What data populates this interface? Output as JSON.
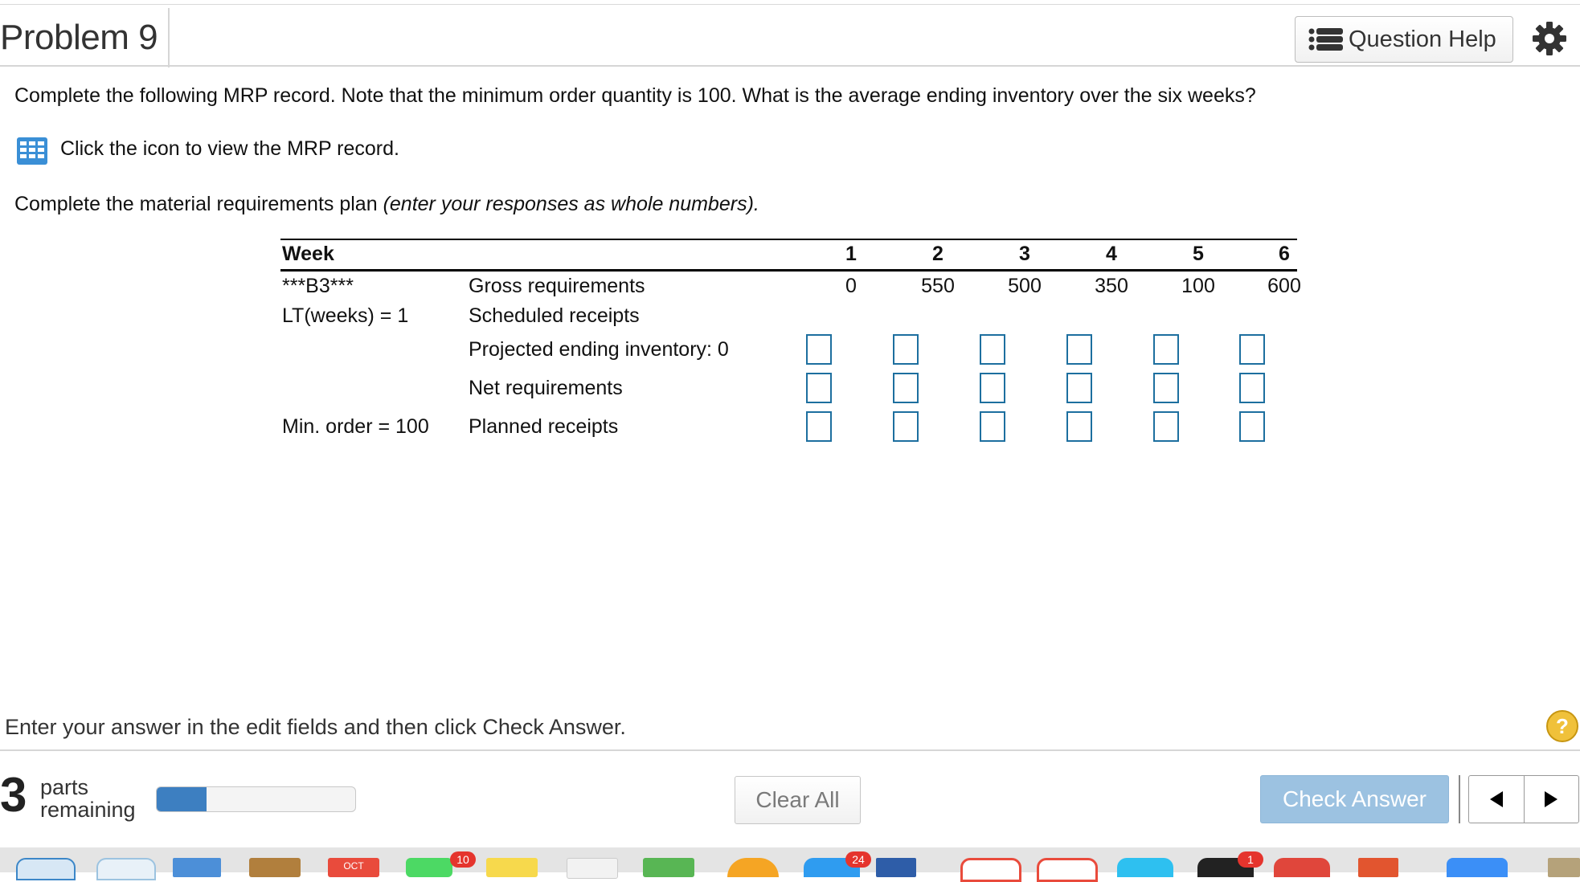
{
  "header": {
    "title": "Problem 9",
    "help_label": "Question Help"
  },
  "question": {
    "prompt": "Complete the following MRP record. Note that the minimum order quantity is 100. What is the average ending inventory over the six weeks?",
    "icon_link": "Click the icon to view the MRP record.",
    "instruction_plain": "Complete the material requirements plan ",
    "instruction_italic": "(enter your responses as whole numbers)."
  },
  "mrp": {
    "week_label": "Week",
    "weeks": [
      "1",
      "2",
      "3",
      "4",
      "5",
      "6"
    ],
    "item": "***B3***",
    "lead_time": "LT(weeks) = 1",
    "min_order": "Min. order = 100",
    "rows": {
      "gross": "Gross requirements",
      "scheduled": "Scheduled receipts",
      "projected": "Projected ending inventory: 0",
      "net": "Net requirements",
      "planned": "Planned receipts"
    },
    "gross_values": [
      "0",
      "550",
      "500",
      "350",
      "100",
      "600"
    ]
  },
  "footer": {
    "instruction": "Enter your answer in the edit fields and then click Check Answer.",
    "parts_count": "3",
    "parts_label_1": "parts",
    "parts_label_2": "remaining",
    "progress": 0.25,
    "clear_label": "Clear All",
    "check_label": "Check Answer",
    "prev_icon": "left-triangle-icon",
    "next_icon": "right-triangle-icon",
    "help_symbol": "?"
  },
  "dock": {
    "badges": [
      "10",
      "24",
      "1"
    ],
    "calendar_month": "OCT"
  },
  "colors": {
    "accent": "#3d7fc1",
    "input_border": "#1d6f9f",
    "check_button": "#9cc2e1",
    "help_circle": "#f0c13a"
  }
}
